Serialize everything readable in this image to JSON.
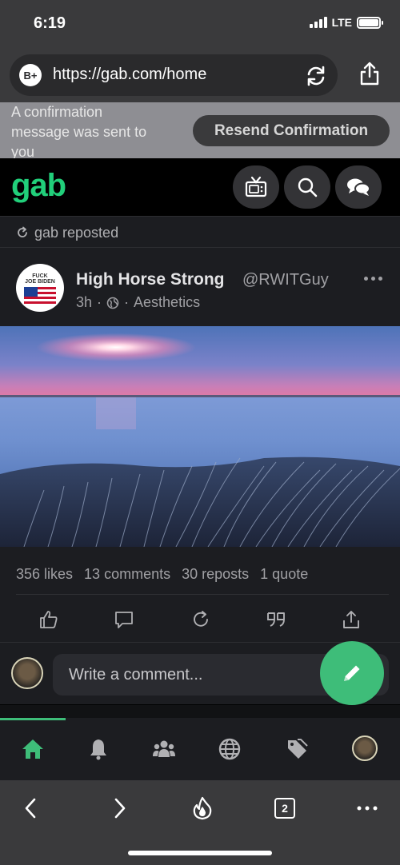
{
  "status_bar": {
    "time": "6:19",
    "network": "LTE"
  },
  "browser": {
    "url": "https://gab.com/home",
    "brave_badge": "B+",
    "tabs_count": "2"
  },
  "banner": {
    "message": "A confirmation message was sent to you",
    "resend_label": "Resend Confirmation"
  },
  "header": {
    "logo": "gab"
  },
  "repost": {
    "label": "gab reposted"
  },
  "post": {
    "avatar_line1": "FUCK",
    "avatar_line2": "JOE BIDEN",
    "display_name": "High Horse Strong",
    "handle": "@RWITGuy",
    "time": "3h",
    "separator": "·",
    "group": "Aesthetics",
    "stats": {
      "likes": "356 likes",
      "comments": "13 comments",
      "reposts": "30 reposts",
      "quotes": "1 quote"
    }
  },
  "comment": {
    "placeholder": "Write a comment..."
  },
  "colors": {
    "brand_green": "#21cf7a",
    "fab_green": "#3ebd79",
    "background": "#1c1d21"
  },
  "icons": {
    "header": [
      "tv-icon",
      "search-icon",
      "chat-icon"
    ],
    "actions": [
      "like-icon",
      "comment-icon",
      "repost-icon",
      "quote-icon",
      "share-icon"
    ],
    "nav": [
      "home-icon",
      "bell-icon",
      "groups-icon",
      "globe-icon",
      "tags-icon"
    ],
    "browser": [
      "back-icon",
      "forward-icon",
      "brave-rewards-icon",
      "tabs-icon",
      "more-icon"
    ]
  }
}
